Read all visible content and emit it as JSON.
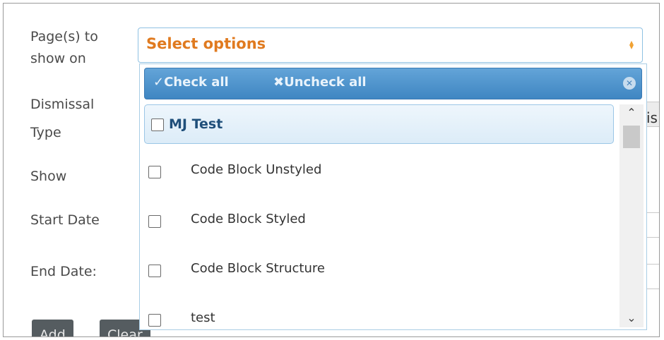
{
  "form": {
    "labels": {
      "pages_line1": "Page(s) to",
      "pages_line2": "show on",
      "dismissal_line1": "Dismissal",
      "dismissal_line2": "Type",
      "show": "Show",
      "start_date": "Start Date",
      "end_date": "End Date:"
    },
    "buttons": {
      "add": "Add",
      "clear": "Clear"
    },
    "background_fragment": "is"
  },
  "select": {
    "placeholder": "Select options",
    "header": {
      "check_all": "✓Check all",
      "uncheck_all": "✖Uncheck all"
    },
    "group": {
      "label": "MJ Test",
      "checked": false
    },
    "items": [
      {
        "label": "Code Block Unstyled",
        "checked": false
      },
      {
        "label": "Code Block Styled",
        "checked": false
      },
      {
        "label": "Code Block Structure",
        "checked": false
      },
      {
        "label": "test",
        "checked": false
      }
    ]
  },
  "colors": {
    "placeholder": "#e07a1f",
    "header_bg": "#4a90c8",
    "group_text": "#1f4f7a"
  }
}
